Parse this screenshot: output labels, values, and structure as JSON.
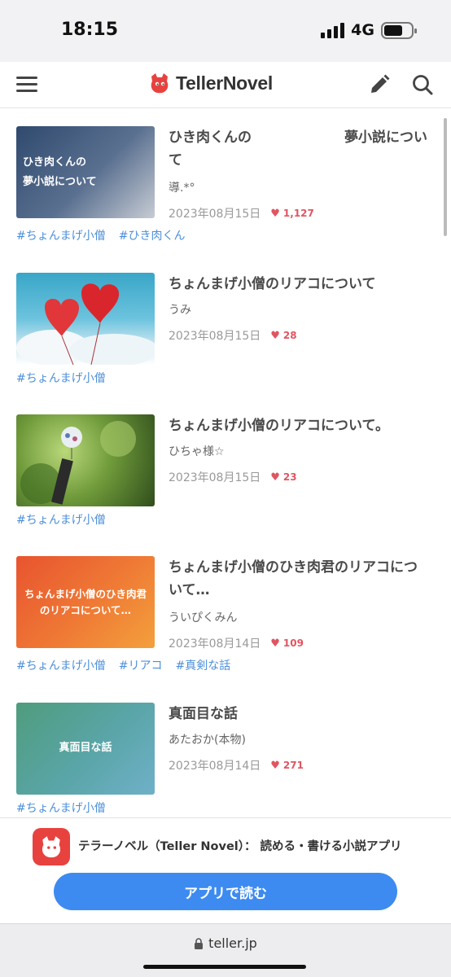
{
  "status": {
    "time": "18:15",
    "network": "4G"
  },
  "header": {
    "logo_text": "TellerNovel"
  },
  "items": [
    {
      "thumb_text": "ひき肉くんの\n夢小説について",
      "title_left": "ひき肉くんの",
      "title_right": "夢小説につい",
      "title_line2": "て",
      "author": "導.*°",
      "date": "2023年08月15日",
      "likes": "1,127",
      "tags": [
        "#ちょんまげ小僧",
        "#ひき肉くん"
      ]
    },
    {
      "title": "ちょんまげ小僧のリアコについて",
      "author": "うみ",
      "date": "2023年08月15日",
      "likes": "28",
      "tags": [
        "#ちょんまげ小僧"
      ]
    },
    {
      "title": "ちょんまげ小僧のリアコについて。",
      "author": "ひちゃ様☆",
      "date": "2023年08月15日",
      "likes": "23",
      "tags": [
        "#ちょんまげ小僧"
      ]
    },
    {
      "thumb_text": "ちょんまげ小僧のひき肉君\nのリアコについて…",
      "title_line1": "ちょんまげ小僧のひき肉君のリアコにつ",
      "title_line2": "いて…",
      "author": "ういぴくみん",
      "date": "2023年08月14日",
      "likes": "109",
      "tags": [
        "#ちょんまげ小僧",
        "#リアコ",
        "#真剣な話"
      ]
    },
    {
      "thumb_text": "真面目な話",
      "title": "真面目な話",
      "author": "あたおか(本物)",
      "date": "2023年08月14日",
      "likes": "271",
      "tags": [
        "#ちょんまげ小僧"
      ]
    }
  ],
  "banner": {
    "app_name": "テラーノベル（Teller Novel）： 読める・書ける小説アプリ",
    "button_label": "アプリで読む"
  },
  "browser": {
    "url": "teller.jp"
  },
  "icons": [
    "menu-icon",
    "logo-mascot-icon",
    "edit-icon",
    "search-icon",
    "heart-icon",
    "lock-icon"
  ],
  "colors": {
    "accent": "#3d8bf0",
    "heart": "#e05561",
    "tag": "#4c8fd9",
    "brand": "#e8423f"
  }
}
